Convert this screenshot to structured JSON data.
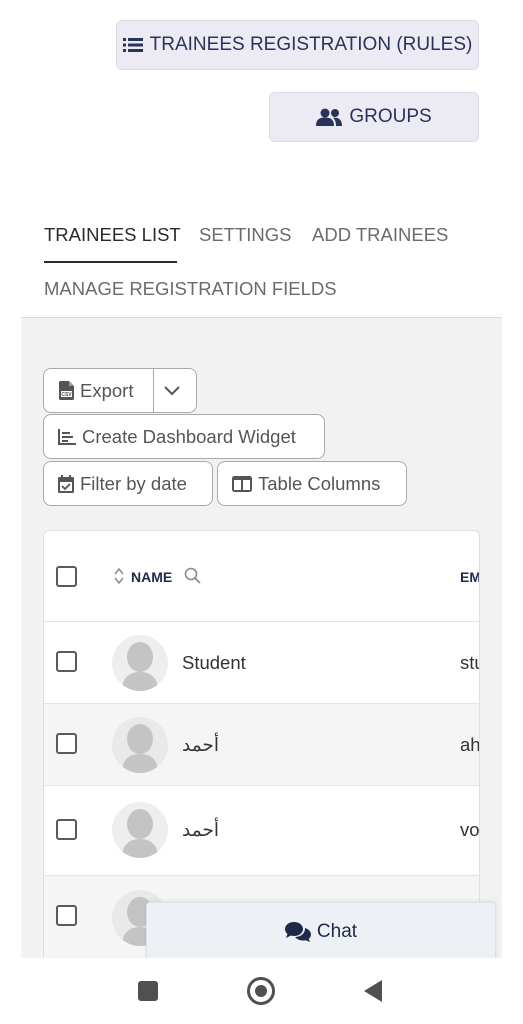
{
  "header_buttons": {
    "rules_label": "TRAINEES REGISTRATION (RULES)",
    "groups_label": "GROUPS"
  },
  "tabs": [
    {
      "label": "TRAINEES LIST",
      "active": true
    },
    {
      "label": "SETTINGS",
      "active": false
    },
    {
      "label": "ADD TRAINEES",
      "active": false
    },
    {
      "label": "MANAGE REGISTRATION FIELDS",
      "active": false
    }
  ],
  "toolbar": {
    "export_label": "Export",
    "widget_label": "Create Dashboard Widget",
    "filter_label": "Filter by date",
    "columns_label": "Table Columns"
  },
  "table": {
    "columns": {
      "name": "NAME",
      "email": "EM"
    },
    "rows": [
      {
        "name": "Student",
        "email": "stu",
        "checked": false
      },
      {
        "name": "أحمد",
        "email": "ah",
        "checked": false
      },
      {
        "name": "أحمد",
        "email": "vo",
        "checked": false
      },
      {
        "name": "",
        "email": "",
        "checked": false
      }
    ]
  },
  "chat": {
    "label": "Chat"
  },
  "colors": {
    "primary_text": "#2b3358",
    "header_button_bg": "#ecebf4",
    "panel_bg": "#f2f2f2",
    "chat_bg": "#edf1f6"
  },
  "icons": {
    "rules": "list-icon",
    "groups": "users-icon",
    "export": "csv-file-icon",
    "widget": "chart-icon",
    "filter": "calendar-icon",
    "columns": "columns-icon",
    "chat": "comments-icon"
  }
}
